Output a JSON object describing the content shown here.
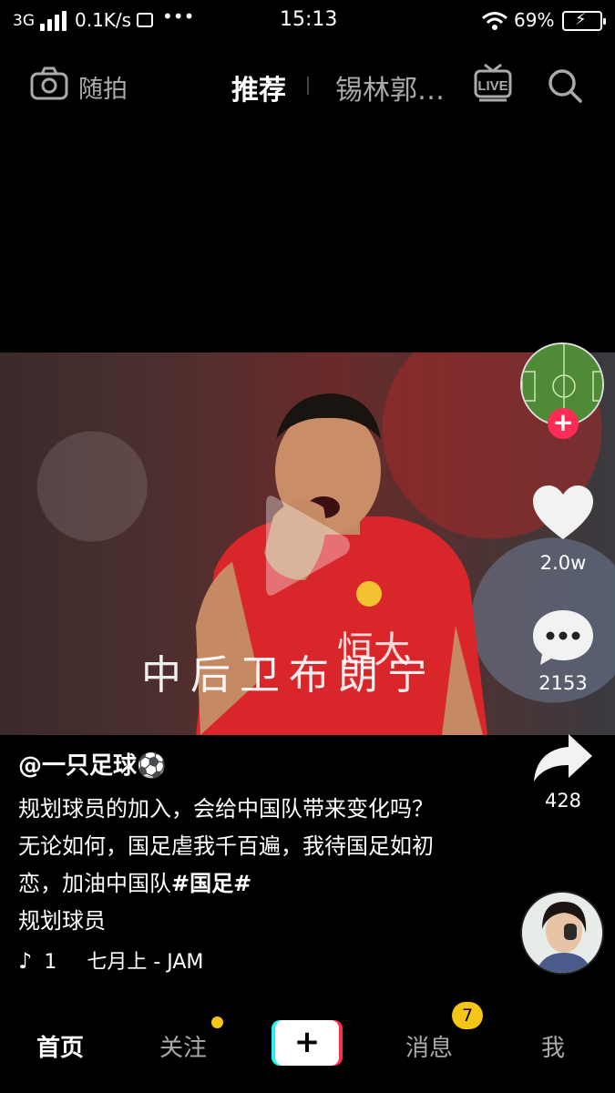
{
  "status_bar": {
    "network": "3G",
    "speed": "0.1K/s",
    "more": "•••",
    "time": "15:13",
    "battery": "69%"
  },
  "top_nav": {
    "camera_label": "随拍",
    "recommend": "推荐",
    "location": "锡林郭…",
    "live_icon": "live-icon",
    "search_icon": "search-icon"
  },
  "video": {
    "overlay_text": "中后卫布朗宁",
    "jersey_text": "恒大"
  },
  "side_rail": {
    "likes": "2.0w",
    "comments": "2153",
    "shares": "428"
  },
  "post": {
    "author": "@一只足球⚽",
    "caption_text": "规划球员的加入，会给中国队带来变化吗？无论如何，国足虐我千百遍，我待国足如初恋，加油中国队",
    "hashtag": "#国足#",
    "caption_tail": "规划球员",
    "music_num": "1",
    "music": "七月上 - JAM"
  },
  "bottom_nav": {
    "home": "首页",
    "follow": "关注",
    "messages": "消息",
    "messages_badge": "7",
    "me": "我"
  },
  "colors": {
    "accent_red": "#fe2c55",
    "badge_yellow": "#f5c518",
    "follow_dot": "#f5c518"
  }
}
